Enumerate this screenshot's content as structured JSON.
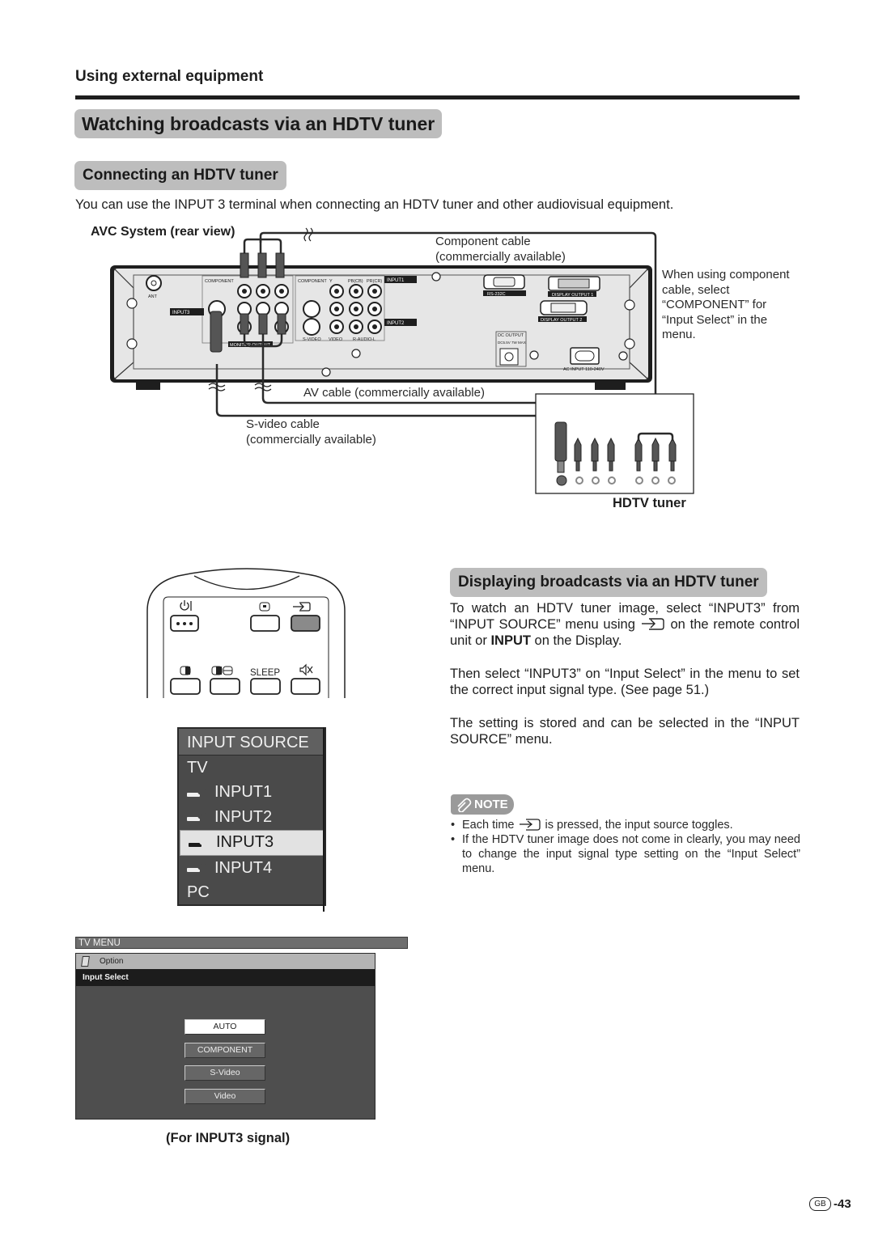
{
  "header": {
    "section": "Using external equipment",
    "title": "Watching broadcasts via an HDTV tuner"
  },
  "connecting": {
    "heading": "Connecting an HDTV tuner",
    "intro": "You can use the INPUT 3 terminal when connecting an HDTV tuner and other audiovisual equipment.",
    "avc_label": "AVC System (rear view)",
    "component_cable": [
      "Component cable",
      "(commercially available)"
    ],
    "component_note": [
      "When using component",
      "cable, select",
      "“COMPONENT” for",
      "“Input Select” in the",
      "menu."
    ],
    "av_cable": "AV cable (commercially available)",
    "svideo_cable": [
      "S-video cable",
      "(commercially available)"
    ],
    "hdtv_tuner_label": "HDTV tuner",
    "panel_labels": {
      "component1": "COMPONENT",
      "component2": "COMPONENT",
      "y": "Y",
      "pb": "PB(CB)",
      "pr": "PR(CR)",
      "input1": "INPUT1",
      "input2": "INPUT2",
      "input3": "INPUT3",
      "ant": "ANT",
      "svideo": "S-VIDEO",
      "video": "VIDEO",
      "audio": "R-AUDIO-L",
      "monitor_output": "MONITOR OUTPUT",
      "rs232c": "RS-232C",
      "display_output1": "DISPLAY OUTPUT 1",
      "display_output2": "DISPLAY OUTPUT 2",
      "dc_output": "DC OUTPUT",
      "dc_rating": "DC5.5V 7W MAX",
      "ac_input": "AC INPUT 110-240V"
    }
  },
  "remote": {
    "labels": {
      "power": "⏻ |",
      "sleep": "SLEEP"
    },
    "icons": [
      "power-icon",
      "display-icon",
      "input-icon",
      "contrast-icon",
      "freeze-icon",
      "sleep",
      "mute-icon"
    ]
  },
  "input_source_menu": {
    "title": "INPUT SOURCE",
    "items": [
      {
        "label": "TV",
        "icon": null,
        "selected": false
      },
      {
        "label": "INPUT1",
        "icon": "1",
        "selected": false
      },
      {
        "label": "INPUT2",
        "icon": "2",
        "selected": false
      },
      {
        "label": "INPUT3",
        "icon": "3",
        "selected": true
      },
      {
        "label": "INPUT4",
        "icon": "4",
        "selected": false
      },
      {
        "label": "PC",
        "icon": null,
        "selected": false
      }
    ]
  },
  "tv_menu": {
    "bar": "TV MENU",
    "option": "Option",
    "submenu": "Input Select",
    "buttons": [
      {
        "label": "AUTO",
        "active": true
      },
      {
        "label": "COMPONENT",
        "active": false
      },
      {
        "label": "S-Video",
        "active": false
      },
      {
        "label": "Video",
        "active": false
      }
    ],
    "caption": "(For INPUT3 signal)"
  },
  "displaying": {
    "heading": "Displaying broadcasts via an HDTV tuner",
    "p1_a": "To watch an HDTV tuner image, select “INPUT3” from “INPUT SOURCE” menu using",
    "p1_b": "on the remote control unit or",
    "p1_bold": "INPUT",
    "p1_c": "on the Display.",
    "p2": "Then select “INPUT3” on “Input Select” in the menu to set the correct input signal type. (See page 51.)",
    "p3": "The setting is stored and can be selected in the “INPUT SOURCE” menu."
  },
  "note": {
    "badge": "NOTE",
    "item1_a": "Each time",
    "item1_b": "is pressed, the input source toggles.",
    "item2": "If the HDTV tuner image does not come in clearly, you may need to change the input signal type setting on the “Input Select” menu."
  },
  "footer": {
    "region": "GB",
    "page": "-43"
  }
}
